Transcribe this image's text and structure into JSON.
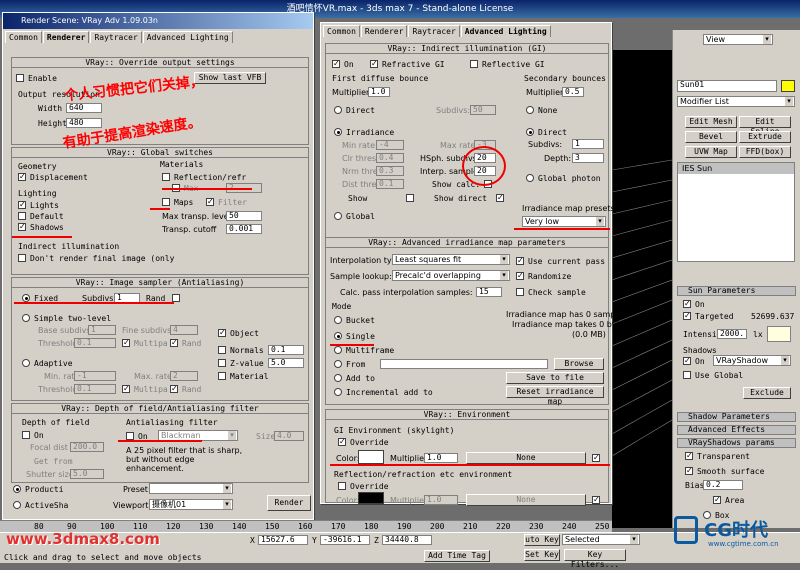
{
  "titlebar": {
    "title": "酒吧情怀VR.max - 3ds max 7 - Stand-alone License"
  },
  "render_scene": {
    "title": "Render Scene: VRay Adv 1.09.03n",
    "tabs": [
      "Common",
      "Renderer",
      "Raytracer",
      "Advanced Lighting"
    ]
  },
  "override": {
    "title": "VRay:: Override output settings",
    "enable": "Enable",
    "show_last_vfb": "Show last VFB",
    "output_resolution": "Output resolution",
    "width_label": "Width",
    "width": "640",
    "height_label": "Height",
    "height": "480"
  },
  "global": {
    "title": "VRay:: Global switches",
    "geometry": "Geometry",
    "displacement": "Displacement",
    "lighting": "Lighting",
    "lights": "Lights",
    "default": "Default",
    "shadows": "Shadows",
    "materials": "Materials",
    "reflection": "Reflection/refr",
    "max": "Max",
    "max_val": "2",
    "maps": "Maps",
    "filter": "Filter",
    "max_transp": "Max transp. levels",
    "max_transp_val": "50",
    "transp_cutoff": "Transp. cutoff",
    "transp_cutoff_val": "0.001",
    "indirect": "Indirect illumination",
    "dont_render": "Don't render final image (only"
  },
  "sampler": {
    "title": "VRay:: Image sampler (Antialiasing)",
    "fixed": "Fixed",
    "subdivs": "Subdivs:",
    "subdivs_val": "1",
    "rand": "Rand",
    "simple": "Simple two-level",
    "base": "Base subdivs:",
    "base_val": "1",
    "fine": "Fine subdivs:",
    "fine_val": "4",
    "threshold": "Threshold:",
    "thr1": "0.1",
    "multipa": "Multipa",
    "rand2": "Rand",
    "object": "Object",
    "normals": "Normals",
    "normals_val": "0.1",
    "zvalue": "Z-value",
    "zvalue_val": "5.0",
    "material": "Material",
    "adaptive": "Adaptive",
    "min_rate": "Min. rate:",
    "min_rate_val": "-1",
    "max_rate": "Max. rate:",
    "max_rate_val": "2",
    "thr2": "0.1"
  },
  "dof": {
    "title": "VRay:: Depth of field/Antialiasing filter",
    "depth": "Depth of field",
    "on": "On",
    "focal": "Focal dist",
    "focal_val": "200.0",
    "get_from": "Get from",
    "shutter": "Shutter size",
    "shutter_val": "5.0",
    "aa_filter": "Antialiasing filter",
    "aa_on": "On",
    "aa_type": "Blackman",
    "size": "Size:",
    "size_val": "4.0",
    "desc": "A 25 pixel filter that is sharp, but without edge enhancement."
  },
  "bottom": {
    "production": "Producti",
    "activeshade": "ActiveSha",
    "preset": "Preset:",
    "viewport": "Viewport:",
    "viewport_val": "摄像机01",
    "render": "Render"
  },
  "gi": {
    "tabs": [
      "Common",
      "Renderer",
      "Raytracer",
      "Advanced Lighting"
    ],
    "title": "VRay:: Indirect illumination (GI)",
    "on": "On",
    "refractive": "Refractive GI",
    "reflective": "Reflective GI",
    "first": "First diffuse bounce",
    "multiplier": "Multiplier:",
    "mult1": "1.0",
    "secondary": "Secondary bounces",
    "mult2": "0.5",
    "direct": "Direct",
    "subdivs": "Subdivs:",
    "subdivs_val": "50",
    "irradiance": "Irradiance",
    "min_rate": "Min rate:",
    "min_rate_val": "-4",
    "max_rate": "Max rate:",
    "max_rate_val": "-3",
    "clr": "Clr thresh:",
    "clr_val": "0.4",
    "hsph": "HSph. subdivs:",
    "hsph_val": "20",
    "nrm": "Nrm thresh:",
    "nrm_val": "0.3",
    "interp": "Interp. samples:",
    "interp_val": "20",
    "dist": "Dist thresh:",
    "dist_val": "0.1",
    "show_calc": "Show calc.",
    "show": "Show",
    "show_direct": "Show direct",
    "global": "Global",
    "none": "None",
    "direct2": "Direct",
    "subdivs2": "Subdivs:",
    "subdivs2_val": "1",
    "depth": "Depth:",
    "depth_val": "3",
    "global_photon": "Global photon",
    "irr_presets": "Irradiance map presets:",
    "preset_val": "Very low"
  },
  "adv": {
    "title": "VRay:: Advanced irradiance map parameters",
    "interp_type": "Interpolation type:",
    "interp_type_val": "Least squares fit",
    "use_current": "Use current pass",
    "sample_lookup": "Sample lookup:",
    "lookup_val": "Precalc'd overlapping",
    "randomize": "Randomize",
    "calc_pass": "Calc. pass interpolation samples:",
    "calc_val": "15",
    "check_sample": "Check sample",
    "mode": "Mode",
    "bucket": "Bucket",
    "single": "Single",
    "multiframe": "Multiframe",
    "from": "From",
    "add_to": "Add to",
    "incremental": "Incremental add to",
    "info1": "Irradiance map has 0 samples",
    "info2": "Irradiance map takes 0 bytes",
    "info3": "(0.0 MB)",
    "browse": "Browse",
    "save": "Save to file",
    "reset": "Reset irradiance map"
  },
  "env": {
    "title": "VRay:: Environment",
    "gi_env": "GI Environment (skylight)",
    "override": "Override",
    "color": "Color:",
    "multiplier": "Multiplier:",
    "mult": "1.0",
    "none": "None",
    "refl_env": "Reflection/refraction etc environment",
    "override2": "Override",
    "mult2": "1.0",
    "none2": "None"
  },
  "cmd": {
    "view": "View",
    "obj": "Sun01",
    "modifier": "Modifier List",
    "edit_mesh": "Edit Mesh",
    "edit_spline": "Edit Spline",
    "bevel": "Bevel",
    "extrude": "Extrude",
    "uvw": "UVW Map",
    "ffd": "FFD(box)",
    "ies_sun": "IES Sun",
    "sun_params": "Sun Parameters",
    "on": "On",
    "targeted": "Targeted",
    "targeted_val": "52699.637",
    "intensity": "Intensity:",
    "intensity_val": "2000.",
    "lx": "lx",
    "shadows": "Shadows",
    "shadow_on": "On",
    "shadow_type": "VRayShadow",
    "use_global": "Use Global",
    "exclude": "Exclude",
    "shadow_params": "Shadow Parameters",
    "adv_effects": "Advanced Effects",
    "vray_params": "VRayShadows params",
    "transparent": "Transparent",
    "smooth": "Smooth surface",
    "bias": "Bias:",
    "bias_val": "0.2",
    "area": "Area",
    "box": "Box"
  },
  "status": {
    "ticks": [
      "80",
      "90",
      "100",
      "110",
      "120",
      "130",
      "140",
      "150",
      "160",
      "170",
      "180",
      "190",
      "200",
      "210",
      "220",
      "230",
      "240",
      "250"
    ],
    "x_label": "X",
    "x_val": "15627.6",
    "y_label": "Y",
    "y_val": "-39616.1",
    "z_label": "Z",
    "z_val": "34440.8",
    "auto_key": "uto Key",
    "selected": "Selected",
    "set_key": "Set Key",
    "key_filters": "Key Filters...",
    "add_time_tag": "Add Time Tag",
    "prompt": "Click and drag to select and move objects",
    "watermark": "www.3dmax8.com",
    "logo": "CG时代",
    "logo_sub": "www.cgtime.com.cn"
  },
  "annotations": {
    "note1": "个人习惯把它们关掉，",
    "note2": "有助于提高渲染速度。"
  }
}
